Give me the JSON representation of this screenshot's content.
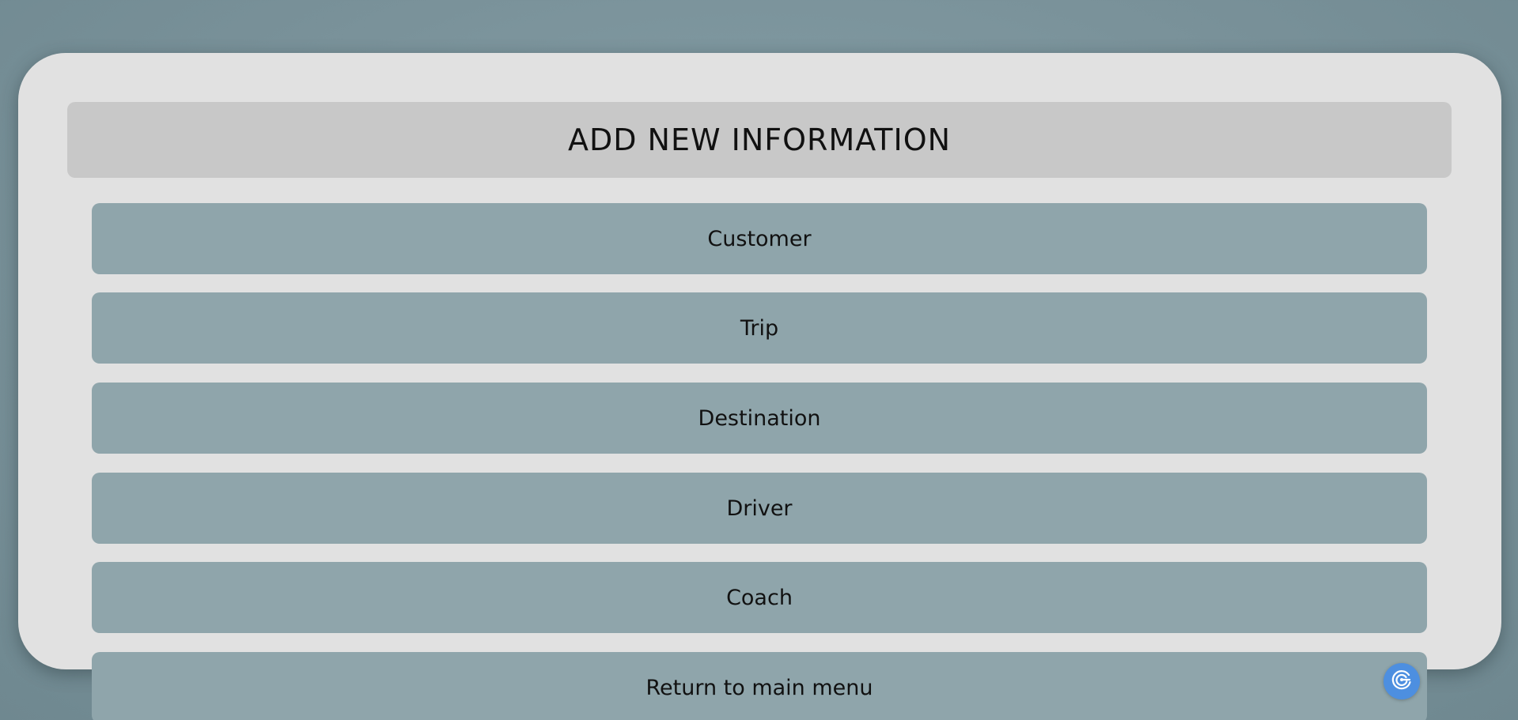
{
  "page": {
    "title": "ADD NEW INFORMATION"
  },
  "menu": {
    "items": [
      {
        "label": "Customer"
      },
      {
        "label": "Trip"
      },
      {
        "label": "Destination"
      },
      {
        "label": "Driver"
      },
      {
        "label": "Coach"
      }
    ],
    "return_label": "Return to main menu"
  },
  "icons": {
    "assistant": "assistant-spiral-icon"
  },
  "colors": {
    "background": "#7a929a",
    "panel": "#e1e1e1",
    "header": "#c8c8c8",
    "button": "#8fa5ab",
    "assistant": "#4d8fe0"
  }
}
